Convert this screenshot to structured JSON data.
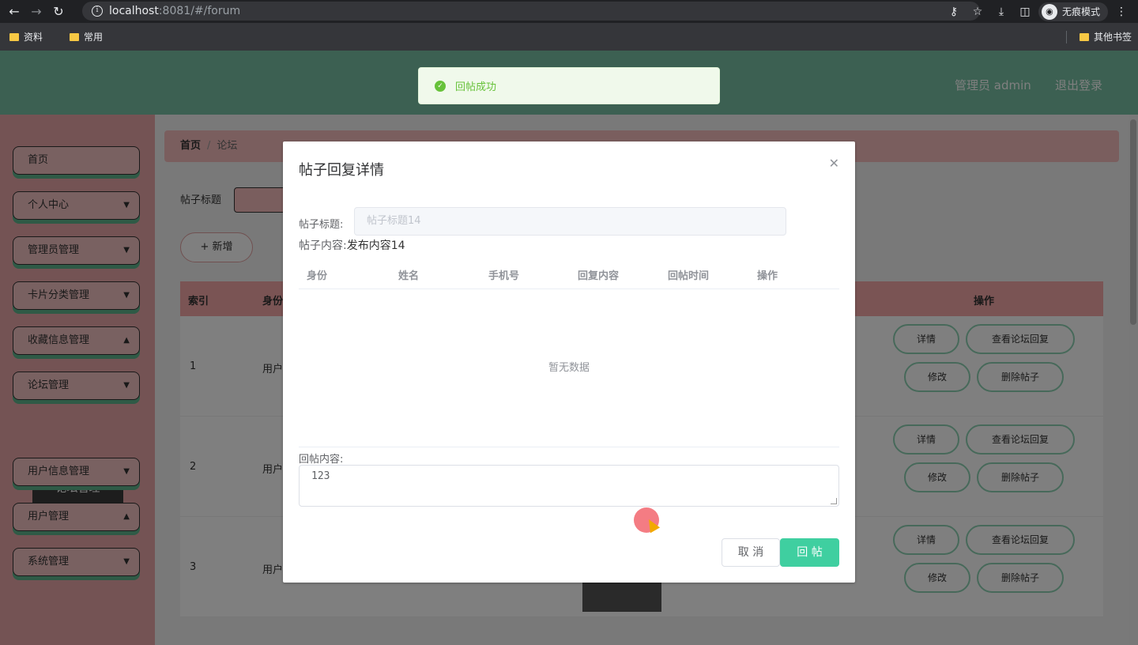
{
  "browser": {
    "url_host": "localhost",
    "url_path": ":8081/#/forum",
    "incognito_label": "无痕模式",
    "bookmarks": [
      "资料",
      "常用"
    ],
    "other_bookmarks": "其他书签"
  },
  "header": {
    "user": "管理员 admin",
    "logout": "退出登录"
  },
  "sidebar": {
    "items": [
      {
        "label": "首页"
      },
      {
        "label": "个人中心"
      },
      {
        "label": "管理员管理"
      },
      {
        "label": "卡片分类管理"
      },
      {
        "label": "收藏信息管理"
      },
      {
        "label": "论坛管理"
      },
      {
        "label": "用户信息管理"
      },
      {
        "label": "用户管理"
      },
      {
        "label": "系统管理"
      }
    ],
    "active_sub": "论坛管理"
  },
  "breadcrumb": {
    "home": "首页",
    "current": "论坛"
  },
  "search": {
    "label": "帖子标题"
  },
  "add_button": "新增",
  "table": {
    "headers": {
      "index": "索引",
      "identity": "身份",
      "ops": "操作"
    },
    "rows": [
      {
        "index": "1",
        "identity": "用户"
      },
      {
        "index": "2",
        "identity": "用户"
      },
      {
        "index": "3",
        "identity": "用户"
      }
    ],
    "row_ops": {
      "detail": "详情",
      "view_reply": "查看论坛回复",
      "edit": "修改",
      "delete": "删除帖子"
    }
  },
  "toast": {
    "message": "回帖成功"
  },
  "dialog": {
    "title": "帖子回复详情",
    "post_title_label": "帖子标题:",
    "post_title_value": "帖子标题14",
    "post_content_label": "帖子内容:",
    "post_content_value": "发布内容14",
    "columns": [
      "身份",
      "姓名",
      "手机号",
      "回复内容",
      "回帖时间",
      "操作"
    ],
    "empty_text": "暂无数据",
    "reply_label": "回帖内容:",
    "reply_value": "123",
    "cancel": "取 消",
    "submit": "回 帖"
  }
}
